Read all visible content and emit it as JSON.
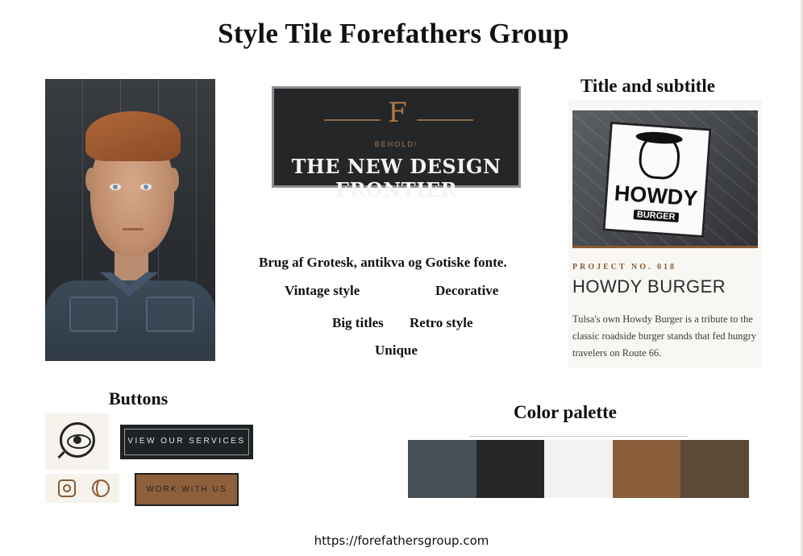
{
  "page": {
    "title": "Style Tile Forefathers Group",
    "url": "https://forefathersgroup.com"
  },
  "banner": {
    "monogram": "F",
    "kicker": "BEHOLD!",
    "headline": "THE NEW DESIGN FRONTIER"
  },
  "typography": {
    "fonts_line": "Brug af Grotesk, antikva og Gotiske fonte.",
    "keywords": [
      "Vintage style",
      "Decorative",
      "Big titles",
      "Retro style",
      "Unique"
    ]
  },
  "title_sample": {
    "heading": "Title and subtitle",
    "sign_word": "HOWDY",
    "sign_sub": "BURGER",
    "project_label": "PROJECT NO. 018",
    "project_name": "HOWDY BURGER",
    "description": "Tulsa's own Howdy Burger is a tribute to the classic roadside burger stands that fed hungry travelers on Route 66."
  },
  "buttons": {
    "heading": "Buttons",
    "primary_label": "VIEW OUR SERVICES",
    "secondary_label": "WORK WITH US",
    "icons": [
      "eye-logo-icon",
      "instagram-icon",
      "dribbble-icon"
    ]
  },
  "palette": {
    "heading": "Color palette",
    "colors": [
      "#464e56",
      "#262828",
      "#f2f2f2",
      "#8b5e3c",
      "#5c4a39"
    ]
  }
}
